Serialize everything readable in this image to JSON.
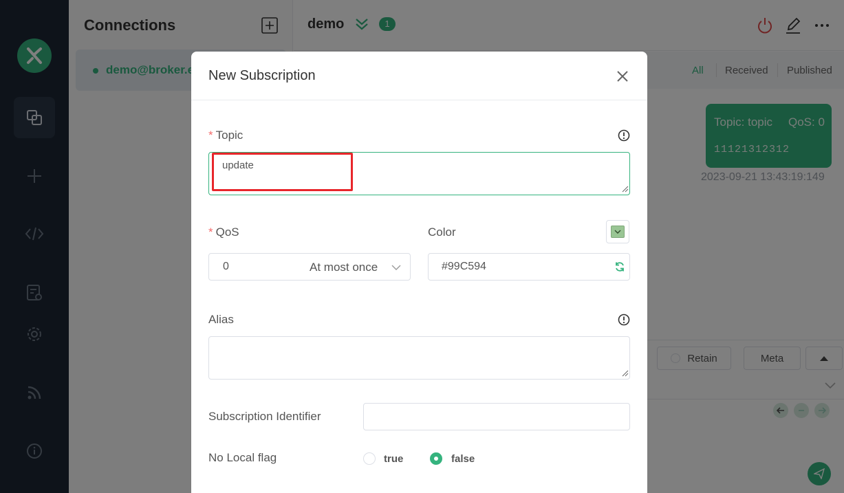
{
  "nav": {
    "icons": [
      "logo-icon",
      "connections-icon",
      "new-icon",
      "script-icon",
      "log-icon",
      "settings-icon",
      "subscribe-feed-icon",
      "about-icon"
    ]
  },
  "connections": {
    "title": "Connections",
    "items": [
      {
        "label": "demo@broker.e"
      }
    ]
  },
  "main": {
    "connection_name": "demo",
    "badge": "1",
    "filters": [
      "All",
      "Received",
      "Published"
    ],
    "message": {
      "topic": "Topic: topic",
      "qos": "QoS: 0",
      "payload": "11121312312",
      "time": "2023-09-21 13:43:19:149"
    },
    "composer": {
      "retain_label": "Retain",
      "meta_label": "Meta"
    }
  },
  "modal": {
    "title": "New Subscription",
    "topic": {
      "label": "Topic",
      "value": "update"
    },
    "qos": {
      "label": "QoS",
      "value": "0",
      "description": "At most once"
    },
    "color": {
      "label": "Color",
      "value": "#99C594"
    },
    "alias": {
      "label": "Alias",
      "value": ""
    },
    "subscription_identifier": {
      "label": "Subscription Identifier",
      "value": ""
    },
    "no_local": {
      "label": "No Local flag",
      "options": [
        "true",
        "false"
      ],
      "selected": "false"
    }
  },
  "colors": {
    "accent": "#35b37e",
    "nav_bg": "#1c2634",
    "highlight": "#e8262b",
    "subscription_color": "#99C594"
  }
}
